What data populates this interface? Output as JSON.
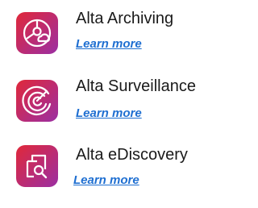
{
  "colors": {
    "title": "#1a1a1a",
    "link": "#1f6fd1",
    "icon_gradient_start": "#d8273d",
    "icon_gradient_end": "#9a2f9f"
  },
  "products": [
    {
      "title": "Alta Archiving",
      "link_label": "Learn more",
      "icon": "archive-cloud-icon"
    },
    {
      "title": "Alta Surveillance",
      "link_label": "Learn more",
      "icon": "radar-icon"
    },
    {
      "title": "Alta eDiscovery",
      "link_label": "Learn more",
      "icon": "document-search-icon"
    }
  ]
}
